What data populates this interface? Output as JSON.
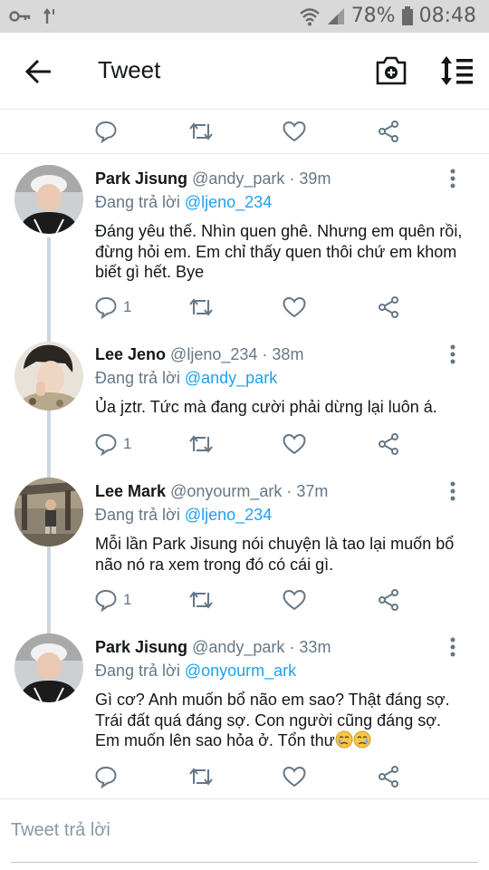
{
  "status_bar": {
    "battery": "78%",
    "time": "08:48"
  },
  "app_bar": {
    "title": "Tweet"
  },
  "reply_prefix": "Đang trả lời",
  "tweets": [
    {
      "name": "Park Jisung",
      "handle": "@andy_park",
      "time": "· 39m",
      "reply_to": "@ljeno_234",
      "text": "Đáng yêu thế. Nhìn quen ghê. Nhưng em quên rồi, đừng hỏi em. Em chỉ thấy quen thôi chứ em khom biết gì hết. Bye",
      "reply_count": "1"
    },
    {
      "name": "Lee Jeno",
      "handle": "@ljeno_234",
      "time": "· 38m",
      "reply_to": "@andy_park",
      "text": "Ủa jztr. Tức mà đang cười phải dừng lại luôn á.",
      "reply_count": "1"
    },
    {
      "name": "Lee Mark",
      "handle": "@onyourm_ark",
      "time": "· 37m",
      "reply_to": "@ljeno_234",
      "text": "Mỗi lần Park Jisung nói chuyện là tao lại muốn bổ não nó ra xem trong đó có cái gì.",
      "reply_count": "1"
    },
    {
      "name": "Park Jisung",
      "handle": "@andy_park",
      "time": "· 33m",
      "reply_to": "@onyourm_ark",
      "text": "Gì cơ? Anh muốn bổ não em sao? Thật đáng sợ. Trái đất quá đáng sợ. Con người cũng đáng sợ. Em muốn lên sao hỏa ở. Tổn thư",
      "reply_count": ""
    }
  ],
  "compose": {
    "placeholder": "Tweet trả lời"
  },
  "colors": {
    "accent": "#1da1f2",
    "muted": "#657786",
    "status_bar_bg": "#d9d9d9"
  }
}
